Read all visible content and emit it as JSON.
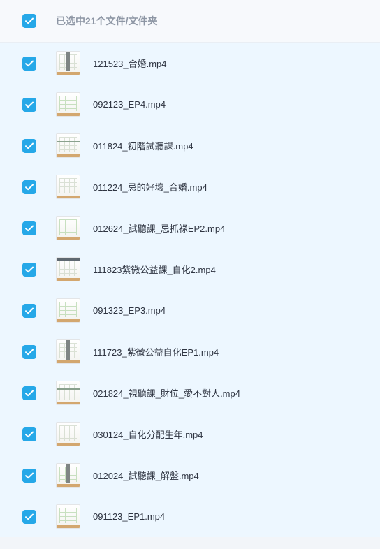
{
  "header": {
    "selection_label": "已选中21个文件/文件夹"
  },
  "files": [
    {
      "name": "121523_合婚.mp4"
    },
    {
      "name": "092123_EP4.mp4"
    },
    {
      "name": "011824_初階試聽課.mp4"
    },
    {
      "name": "011224_忌的好壞_合婚.mp4"
    },
    {
      "name": "012624_試聽課_忌抓祿EP2.mp4"
    },
    {
      "name": "111823紫微公益課_自化2.mp4"
    },
    {
      "name": "091323_EP3.mp4"
    },
    {
      "name": "111723_紫微公益自化EP1.mp4"
    },
    {
      "name": "021824_視聽課_財位_愛不對人.mp4"
    },
    {
      "name": "030124_自化分配生年.mp4"
    },
    {
      "name": "012024_試聽課_解盤.mp4"
    },
    {
      "name": "091123_EP1.mp4"
    }
  ],
  "colors": {
    "checkbox": "#26a8e8",
    "header_text": "#8d96a4",
    "row_background": "#edf7ff"
  }
}
